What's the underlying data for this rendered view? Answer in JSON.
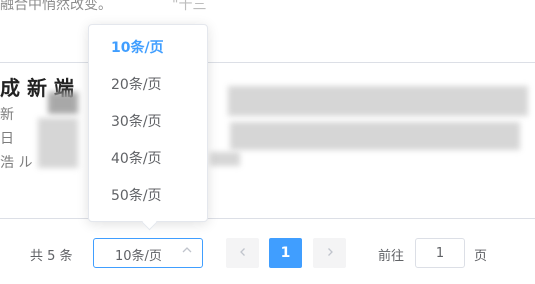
{
  "background_text": {
    "top_line": "融合中悄然改变。",
    "top_tail": "\"十三",
    "title": "成 新 端",
    "lines": [
      "新",
      "日",
      "浩 ル"
    ]
  },
  "dropdown": {
    "items": [
      {
        "label": "10条/页",
        "selected": true
      },
      {
        "label": "20条/页",
        "selected": false
      },
      {
        "label": "30条/页",
        "selected": false
      },
      {
        "label": "40条/页",
        "selected": false
      },
      {
        "label": "50条/页",
        "selected": false
      }
    ]
  },
  "pagination": {
    "total_label": "共 5 条",
    "page_size_value": "10条/页",
    "chevron_icon": "chevron-up-icon",
    "prev_icon": "chevron-left-icon",
    "next_icon": "chevron-right-icon",
    "current_page": "1",
    "goto_label": "前往",
    "goto_value": "1",
    "goto_suffix": "页"
  },
  "colors": {
    "accent": "#409eff",
    "text": "#606266",
    "disabled_bg": "#f4f4f5",
    "border": "#dcdfe6"
  }
}
